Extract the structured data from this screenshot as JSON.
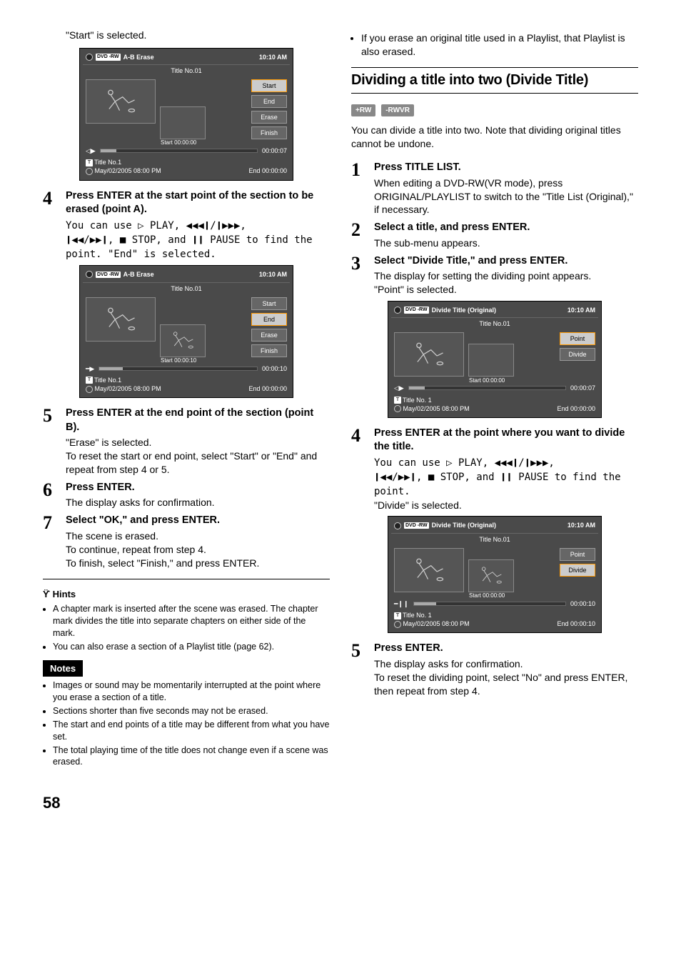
{
  "left": {
    "opening_line": "\"Start\" is selected.",
    "panel1": {
      "disc_type": "DVD -RW",
      "title_bar": "A-B Erase",
      "time": "10:10 AM",
      "subtitle": "Title No.01",
      "start_label": "Start 00:00:00",
      "end_label": "End 00:00:00",
      "progress_time": "00:00:07",
      "btn_start": "Start",
      "btn_end": "End",
      "btn_erase": "Erase",
      "btn_finish": "Finish",
      "title_no": "Title No.1",
      "timestamp": "May/02/2005 08:00 PM",
      "selected": "Start"
    },
    "step4_head": "Press ENTER at the start point of the section to be erased (point A).",
    "step4_text_a": "You can use ▷ PLAY, ◀◀◀❙/❙▶▶▶,",
    "step4_text_b": "❙◀◀/▶▶❙, ■ STOP, and ❙❙ PAUSE to find the point. \"End\" is selected.",
    "panel2": {
      "disc_type": "DVD -RW",
      "title_bar": "A-B Erase",
      "time": "10:10 AM",
      "subtitle": "Title No.01",
      "start_label": "Start 00:00:10",
      "end_label": "End 00:00:00",
      "progress_time": "00:00:10",
      "btn_start": "Start",
      "btn_end": "End",
      "btn_erase": "Erase",
      "btn_finish": "Finish",
      "title_no": "Title No.1",
      "timestamp": "May/02/2005 08:00 PM",
      "selected": "End"
    },
    "step5_head": "Press ENTER at the end point of the section (point B).",
    "step5_text": "\"Erase\" is selected.\nTo reset the start or end point, select \"Start\" or \"End\" and repeat from step 4 or 5.",
    "step6_head": "Press ENTER.",
    "step6_text": "The display asks for confirmation.",
    "step7_head": "Select \"OK,\" and press ENTER.",
    "step7_text": "The scene is erased.\nTo continue, repeat from step 4.\nTo finish, select \"Finish,\" and press ENTER.",
    "hints_label": "Hints",
    "hints": [
      "A chapter mark is inserted after the scene was erased. The chapter mark divides the title into separate chapters on either side of the mark.",
      "You can also erase a section of a Playlist title (page 62)."
    ],
    "notes_label": "Notes",
    "notes": [
      "Images or sound may be momentarily interrupted at the point where you erase a section of a title.",
      "Sections shorter than five seconds may not be erased.",
      "The start and end points of a title may be different from what you have set.",
      "The total playing time of the title does not change even if a scene was erased."
    ]
  },
  "right": {
    "top_bullet": "If you erase an original title used in a Playlist, that Playlist is also erased.",
    "section_title": "Dividing a title into two (Divide Title)",
    "badge1": "+RW",
    "badge2": "-RWVR",
    "intro": "You can divide a title into two. Note that dividing original titles cannot be undone.",
    "step1_head": "Press TITLE LIST.",
    "step1_text": "When editing a DVD-RW(VR mode), press ORIGINAL/PLAYLIST to switch to the \"Title List (Original),\" if necessary.",
    "step2_head": "Select a title, and press ENTER.",
    "step2_text": "The sub-menu appears.",
    "step3_head": "Select \"Divide Title,\" and press ENTER.",
    "step3_text": "The display for setting the dividing point appears.\n\"Point\" is selected.",
    "panel3": {
      "disc_type": "DVD -RW",
      "title_bar": "Divide Title (Original)",
      "time": "10:10 AM",
      "subtitle": "Title No.01",
      "start_label": "Start 00:00:00",
      "end_label": "End 00:00:00",
      "progress_time": "00:00:07",
      "btn_point": "Point",
      "btn_divide": "Divide",
      "title_no": "Title No. 1",
      "timestamp": "May/02/2005 08:00 PM",
      "selected": "Point"
    },
    "step4_head": "Press ENTER at the point where you want to divide the title.",
    "step4_text_a": "You can use ▷ PLAY, ◀◀◀❙/❙▶▶▶,",
    "step4_text_b": "❙◀◀/▶▶❙, ■ STOP, and ❙❙ PAUSE to find the point.",
    "step4_text_c": "\"Divide\" is selected.",
    "panel4": {
      "disc_type": "DVD -RW",
      "title_bar": "Divide Title (Original)",
      "time": "10:10 AM",
      "subtitle": "Title No.01",
      "start_label": "Start 00:00:00",
      "end_label": "End 00:00:10",
      "progress_time": "00:00:10",
      "btn_point": "Point",
      "btn_divide": "Divide",
      "title_no": "Title No. 1",
      "timestamp": "May/02/2005 08:00 PM",
      "selected": "Divide"
    },
    "step5_head": "Press ENTER.",
    "step5_text": "The display asks for confirmation.\nTo reset the dividing point, select \"No\" and press ENTER, then repeat from step 4."
  },
  "page_number": "58"
}
